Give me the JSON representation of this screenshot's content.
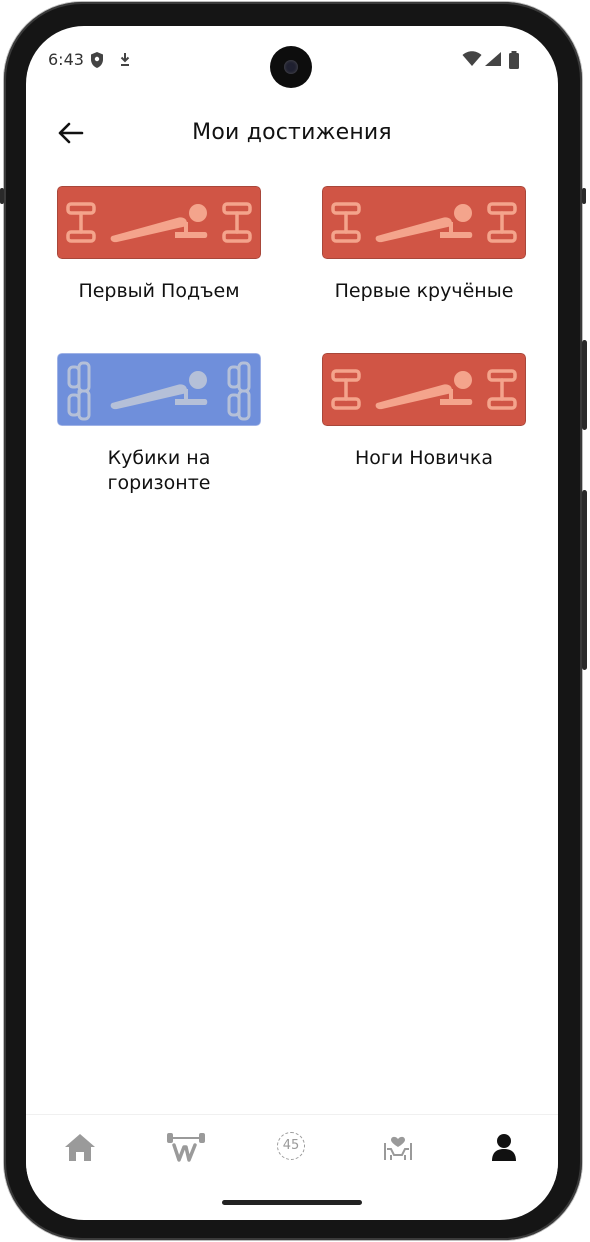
{
  "status_bar": {
    "time": "6:43",
    "left_icons": [
      "shield-icon",
      "download-icon"
    ],
    "right_icons": [
      "wifi-icon",
      "signal-icon",
      "battery-icon"
    ]
  },
  "header": {
    "title": "Мои достижения",
    "back_icon": "arrow-left-icon"
  },
  "achievements": [
    {
      "label": "Первый Подъем",
      "state": "earned",
      "color": "#d05545"
    },
    {
      "label": "Первые кручёные",
      "state": "earned",
      "color": "#d05545"
    },
    {
      "label": "Кубики на горизонте",
      "state": "locked",
      "color": "#6f8fdb"
    },
    {
      "label": "Ноги Новичка",
      "state": "earned",
      "color": "#d05545"
    }
  ],
  "bottom_nav": {
    "items": [
      {
        "icon": "home-icon",
        "active": false
      },
      {
        "icon": "workout-icon",
        "active": false
      },
      {
        "icon": "timer-45-icon",
        "text": "45",
        "active": false
      },
      {
        "icon": "health-icon",
        "active": false
      },
      {
        "icon": "profile-icon",
        "active": true
      }
    ]
  },
  "colors": {
    "earned_bg": "#d05545",
    "earned_fg": "#f4a48c",
    "locked_bg": "#6f8fdb",
    "locked_fg": "#b5c0d8",
    "nav_inactive": "#9a9a9a",
    "nav_active": "#111111"
  }
}
